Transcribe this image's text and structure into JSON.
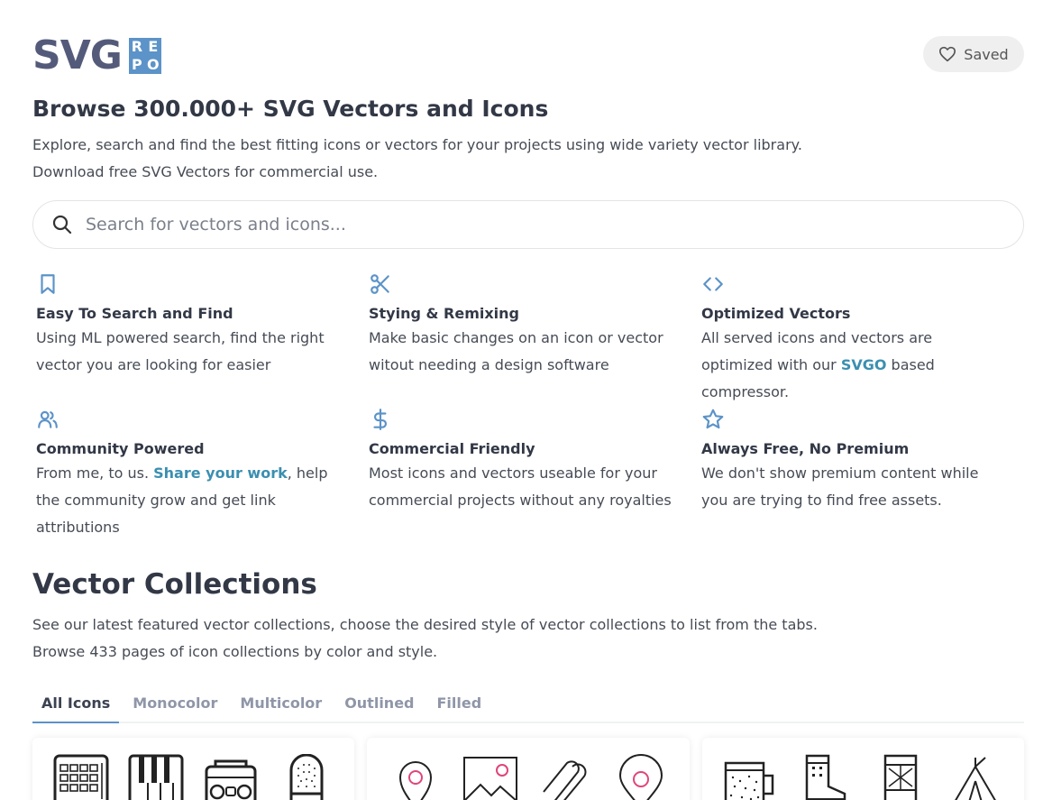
{
  "logo": {
    "wordmark": "SVG",
    "badge": [
      "R",
      "E",
      "P",
      "O"
    ]
  },
  "header": {
    "saved_label": "Saved"
  },
  "hero": {
    "title": "Browse 300.000+ SVG Vectors and Icons",
    "desc_line1": "Explore, search and find the best fitting icons or vectors for your projects using wide variety vector library.",
    "desc_line2": "Download free SVG Vectors for commercial use."
  },
  "search": {
    "placeholder": "Search for vectors and icons..."
  },
  "features": [
    {
      "icon": "bookmark-icon",
      "title": "Easy To Search and Find",
      "text": "Using ML powered search, find the right vector you are looking for easier"
    },
    {
      "icon": "scissors-icon",
      "title": "Stying & Remixing",
      "text": "Make basic changes on an icon or vector witout needing a design software"
    },
    {
      "icon": "code-icon",
      "title": "Optimized Vectors",
      "text_before": "All served icons and vectors are optimized with our ",
      "link": "SVGO",
      "text_after": " based compressor."
    },
    {
      "icon": "users-icon",
      "title": "Community Powered",
      "text_before": "From me, to us. ",
      "link": "Share your work",
      "text_after": ", help the community grow and get link attributions"
    },
    {
      "icon": "dollar-icon",
      "title": "Commercial Friendly",
      "text": "Most icons and vectors useable for your commercial projects without any royalties"
    },
    {
      "icon": "star-icon",
      "title": "Always Free, No Premium",
      "text": "We don't show premium content while you are trying to find free assets."
    }
  ],
  "collections": {
    "title": "Vector Collections",
    "desc_line1": "See our latest featured vector collections, choose the desired style of vector collections to list from the tabs.",
    "desc_line2": "Browse 433 pages of icon collections by color and style.",
    "tabs": [
      "All Icons",
      "Monocolor",
      "Multicolor",
      "Outlined",
      "Filled"
    ],
    "active_tab": "All Icons"
  },
  "colors": {
    "accent": "#5c93c8",
    "link": "#3b8fb0",
    "heading": "#323846",
    "logo": "#545b7a",
    "pin": "#e0457b"
  }
}
